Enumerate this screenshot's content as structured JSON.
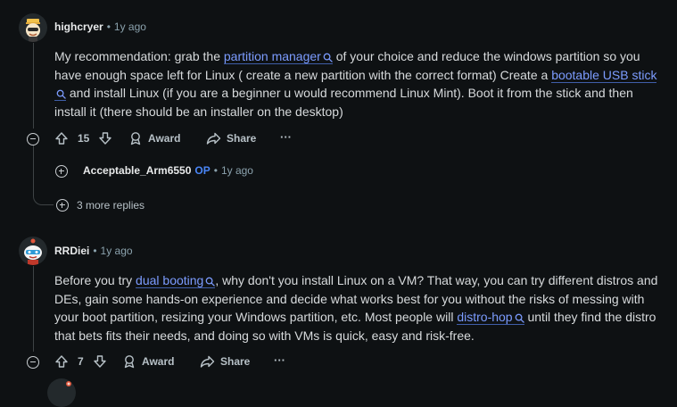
{
  "comments": [
    {
      "author": "highcryer",
      "time": "1y ago",
      "body_parts": [
        {
          "text": "My recommendation: grab the "
        },
        {
          "kw": "partition manager"
        },
        {
          "text": " of your choice and reduce the windows partition so you have enough space left for Linux ( create a new partition with the correct format) Create a "
        },
        {
          "kw": "bootable USB stick"
        },
        {
          "text": " and install Linux (if you are a beginner u would recommend Linux Mint). Boot it from the stick and then install it (there should be an installer on the desktop)"
        }
      ],
      "votes": "15",
      "award_label": "Award",
      "share_label": "Share",
      "more_label": "···"
    },
    {
      "author": "RRDiei",
      "time": "1y ago",
      "body_parts": [
        {
          "text": "Before you try "
        },
        {
          "kw": "dual booting"
        },
        {
          "text": ", why don't you install Linux on a VM? That way, you can try different distros and DEs, gain some hands-on experience and decide what works best for you without the risks of messing with your boot partition, resizing your Windows partition, etc. Most people will "
        },
        {
          "kw": "distro-hop"
        },
        {
          "text": " until they find the distro that bets fits their needs, and doing so with VMs is quick, easy and risk-free."
        }
      ],
      "votes": "7",
      "award_label": "Award",
      "share_label": "Share",
      "more_label": "···"
    }
  ],
  "reply": {
    "author": "Acceptable_Arm6550",
    "op_badge": "OP",
    "time": "1y ago"
  },
  "more_replies": "3 more replies",
  "separator": "•"
}
